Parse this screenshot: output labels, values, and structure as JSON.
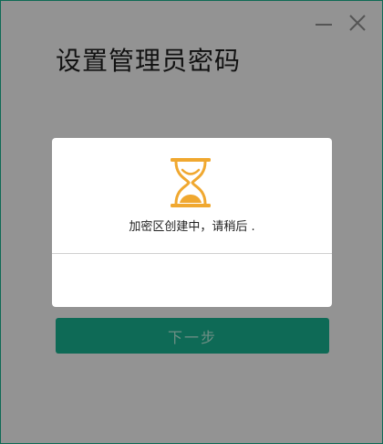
{
  "window": {
    "minimize_icon": "minimize-icon",
    "close_icon": "close-icon"
  },
  "page": {
    "title": "设置管理员密码"
  },
  "modal": {
    "icon": "hourglass-icon",
    "status_text": "加密区创建中，请稍后 ."
  },
  "actions": {
    "next_label": "下一步"
  },
  "colors": {
    "background": "#939393",
    "accent": "#0e6a56",
    "hourglass": "#f0a830",
    "button_text_disabled": "#6f8f85"
  }
}
